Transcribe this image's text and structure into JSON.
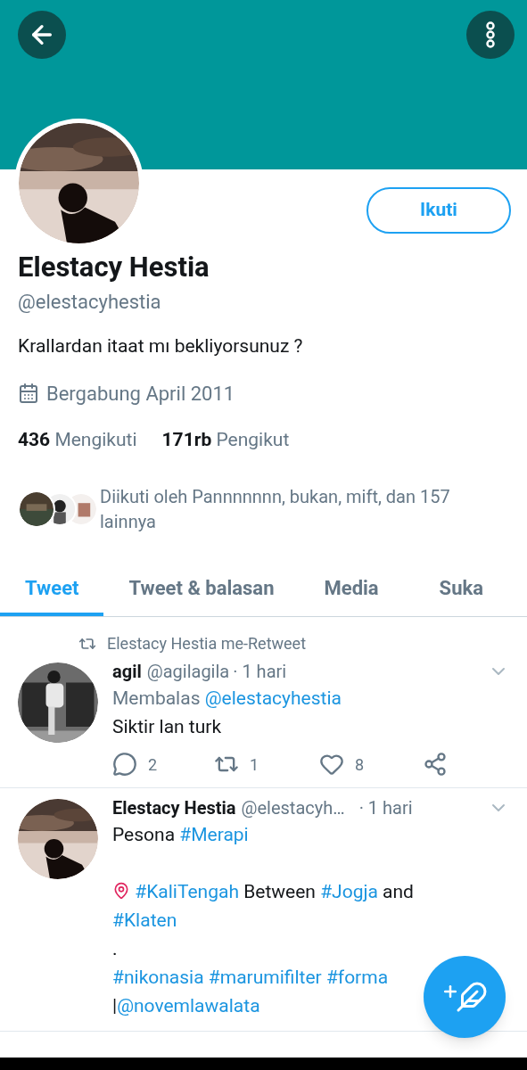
{
  "profile": {
    "follow_button": "Ikuti",
    "name": "Elestacy Hestia",
    "handle": "@elestacyhestia",
    "bio": "Krallardan itaat mı bekliyorsunuz ?",
    "joined": "Bergabung April 2011",
    "stats": [
      {
        "count": "436",
        "label": "Mengikuti"
      },
      {
        "count": "171rb",
        "label": "Pengikut"
      }
    ],
    "followed_by": "Diikuti oleh Pannnnnnn, bukan, mift, dan 157 lainnya"
  },
  "tabs": [
    {
      "label": "Tweet",
      "selected": true
    },
    {
      "label": "Tweet & balasan",
      "selected": false
    },
    {
      "label": "Media",
      "selected": false
    },
    {
      "label": "Suka",
      "selected": false
    }
  ],
  "tweets": [
    {
      "retweeted_by": "Elestacy Hestia me-Retweet",
      "name": "agil",
      "handle": "@agilagila",
      "time": "· 1 hari",
      "reply_label": "Membalas",
      "reply_to": "@elestacyhestia",
      "paragraphs": [
        [
          [
            {
              "kind": "text",
              "text": "Siktir lan turk"
            }
          ]
        ]
      ],
      "actions": {
        "replies": "2",
        "retweets": "1",
        "likes": "8"
      }
    },
    {
      "name": "Elestacy Hestia",
      "handle": "@elestacyh…",
      "time": "· 1 hari",
      "paragraphs": [
        [
          [
            {
              "kind": "text",
              "text": "Pesona "
            },
            {
              "kind": "link",
              "text": "#Merapi"
            }
          ]
        ],
        [
          [
            {
              "kind": "pin"
            },
            {
              "kind": "link",
              "text": " #KaliTengah"
            },
            {
              "kind": "text",
              "text": " Between "
            },
            {
              "kind": "link",
              "text": "#Jogja"
            },
            {
              "kind": "text",
              "text": " and"
            }
          ],
          [
            {
              "kind": "link",
              "text": "#Klaten"
            }
          ],
          [
            {
              "kind": "text",
              "text": "."
            }
          ],
          [
            {
              "kind": "link",
              "text": "#nikonasia #marumifilter #forma"
            }
          ],
          [
            {
              "kind": "text",
              "text": "|"
            },
            {
              "kind": "link",
              "text": "@novemlawalata"
            }
          ]
        ]
      ]
    }
  ]
}
